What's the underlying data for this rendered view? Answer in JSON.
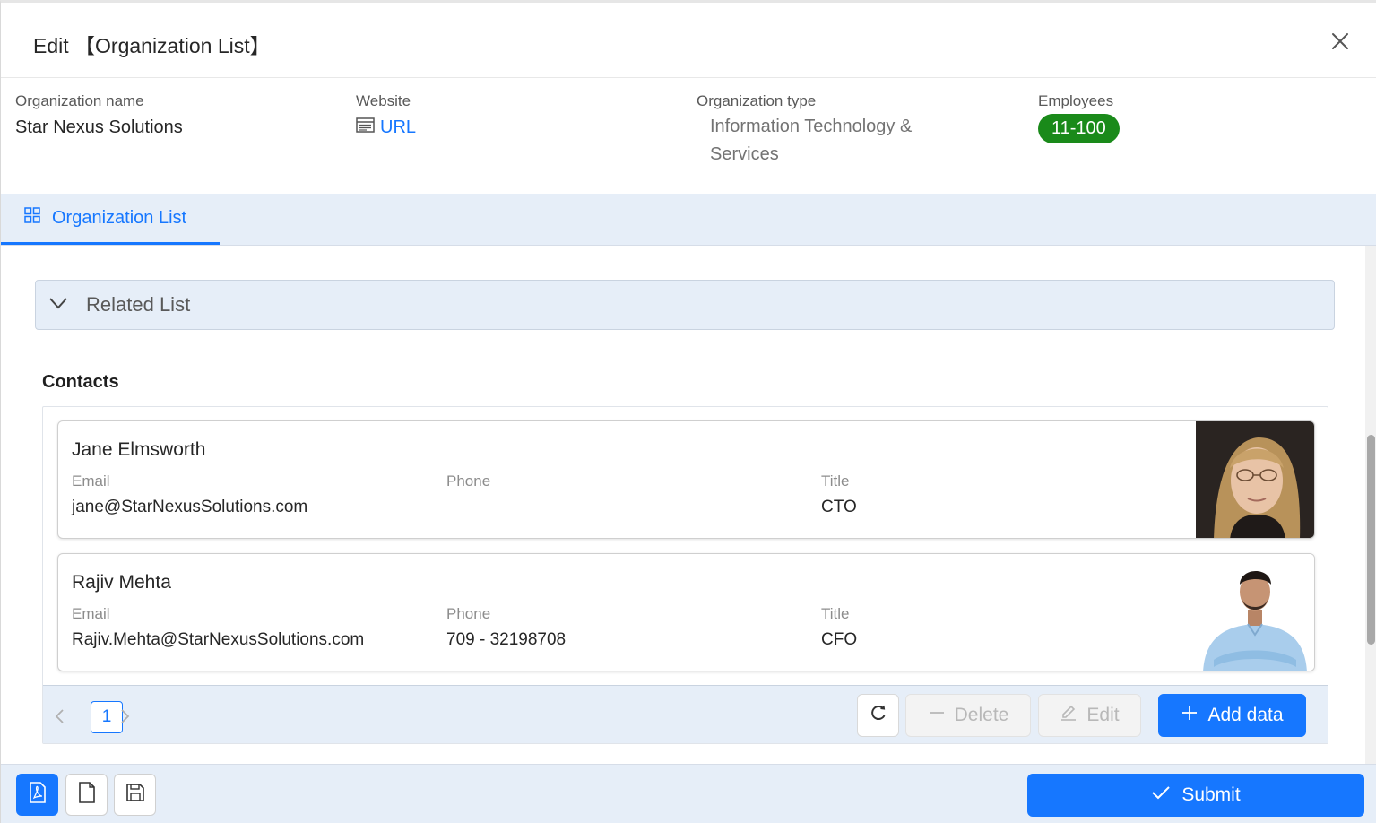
{
  "header": {
    "title": "Edit 【Organization List】",
    "close_icon": "close-icon"
  },
  "info": {
    "org_name_label": "Organization name",
    "org_name_value": "Star Nexus Solutions",
    "website_label": "Website",
    "website_value": "URL",
    "org_type_label": "Organization type",
    "org_type_value": "Information Technology & Services",
    "employees_label": "Employees",
    "employees_value": "11-100",
    "employees_badge_color": "#1a8a1a"
  },
  "tabs": [
    {
      "label": "Organization List",
      "icon": "grid-icon",
      "active": true
    }
  ],
  "related": {
    "label": "Related List",
    "expanded": true
  },
  "contacts": {
    "title": "Contacts",
    "items": [
      {
        "name": "Jane Elmsworth",
        "email_label": "Email",
        "email": "jane@StarNexusSolutions.com",
        "phone_label": "Phone",
        "phone": "",
        "title_label": "Title",
        "title": "CTO",
        "photo": "woman-portrait"
      },
      {
        "name": "Rajiv Mehta",
        "email_label": "Email",
        "email": "Rajiv.Mehta@StarNexusSolutions.com",
        "phone_label": "Phone",
        "phone": "709 - 32198708",
        "title_label": "Title",
        "title": "CFO",
        "photo": "man-portrait"
      }
    ],
    "pagination": {
      "current": "1"
    },
    "actions": {
      "delete": "Delete",
      "edit": "Edit",
      "add": "Add data"
    }
  },
  "footer": {
    "submit": "Submit"
  },
  "colors": {
    "primary": "#1677ff",
    "tab_bg": "#e6eef8"
  }
}
